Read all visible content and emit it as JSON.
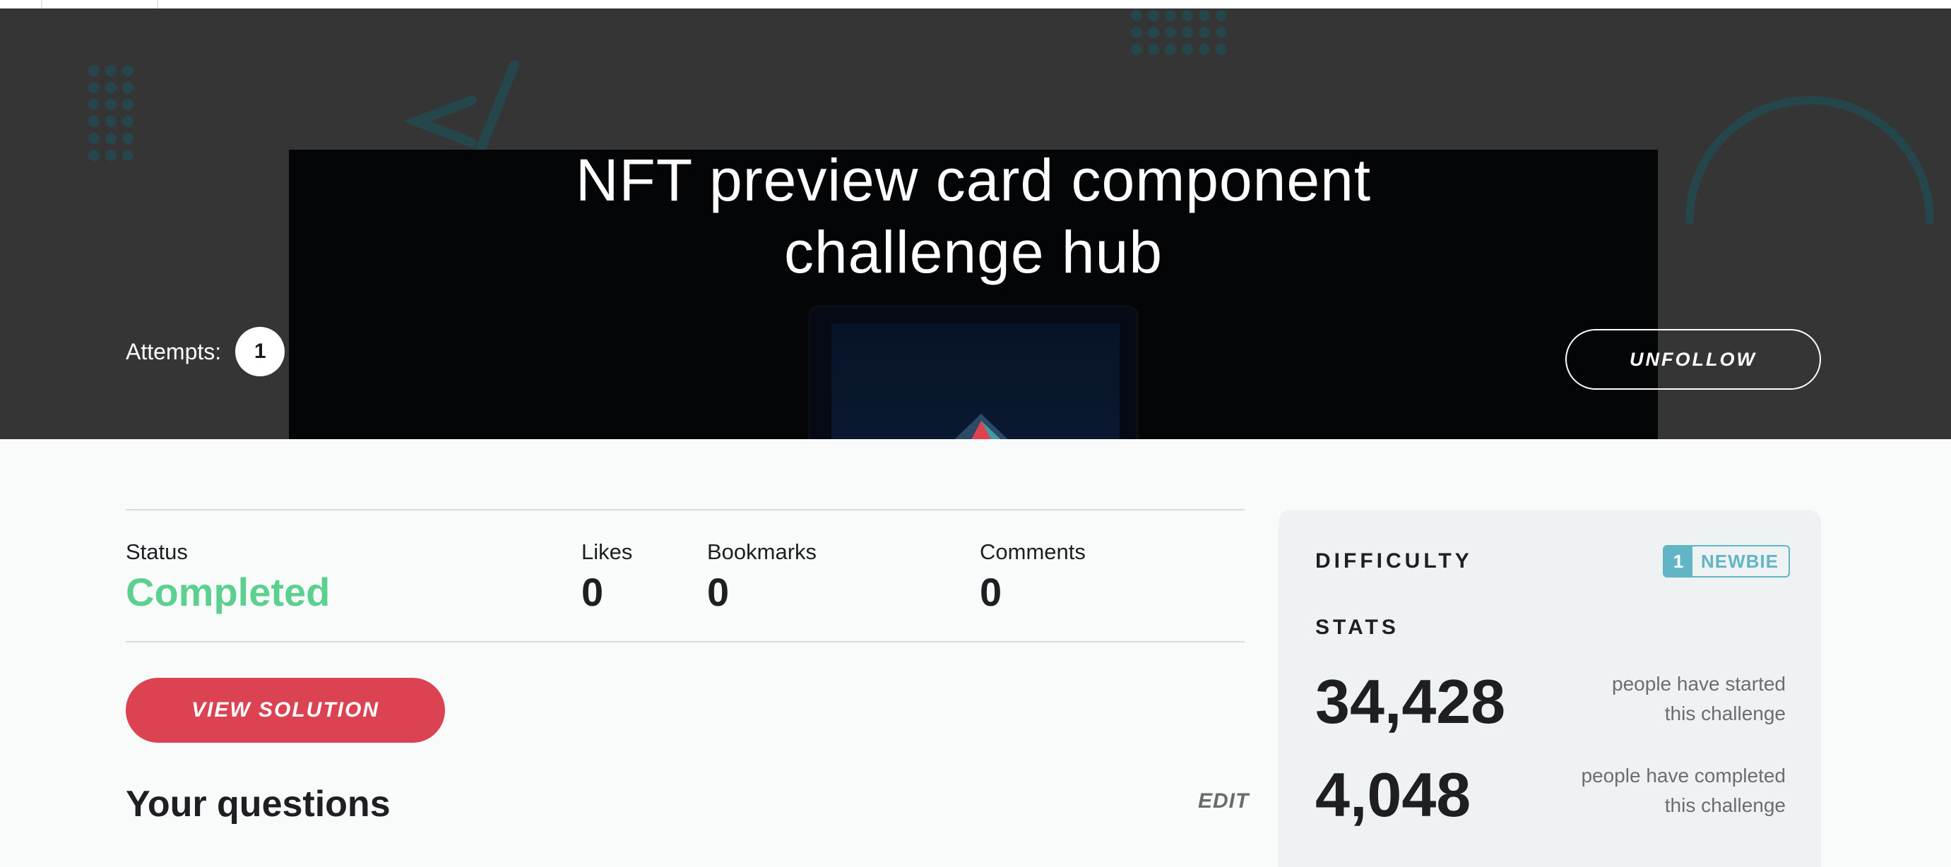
{
  "hero": {
    "title_line1": "NFT preview card component",
    "title_line2": "challenge hub",
    "attempts_label": "Attempts:",
    "attempts_count": "1",
    "unfollow_label": "UNFOLLOW",
    "decor_code_glyph": "</"
  },
  "colors": {
    "hero_bg": "#353535",
    "completed_green": "#5bd08f",
    "primary_red": "#dc4352",
    "newbie_teal": "#62b5c5",
    "panel_bg": "#eef2f3"
  },
  "status": {
    "status_label": "Status",
    "status_value": "Completed",
    "likes_label": "Likes",
    "likes_value": "0",
    "bookmarks_label": "Bookmarks",
    "bookmarks_value": "0",
    "comments_label": "Comments",
    "comments_value": "0"
  },
  "actions": {
    "view_solution_label": "VIEW SOLUTION"
  },
  "questions": {
    "title": "Your questions",
    "edit_label": "EDIT"
  },
  "panel": {
    "difficulty_label": "DIFFICULTY",
    "difficulty_level": "1",
    "difficulty_name": "NEWBIE",
    "stats_label": "STATS",
    "started_count": "34,428",
    "started_desc_line1": "people have started",
    "started_desc_line2": "this challenge",
    "completed_count": "4,048",
    "completed_desc_line1": "people have completed",
    "completed_desc_line2": "this challenge"
  }
}
